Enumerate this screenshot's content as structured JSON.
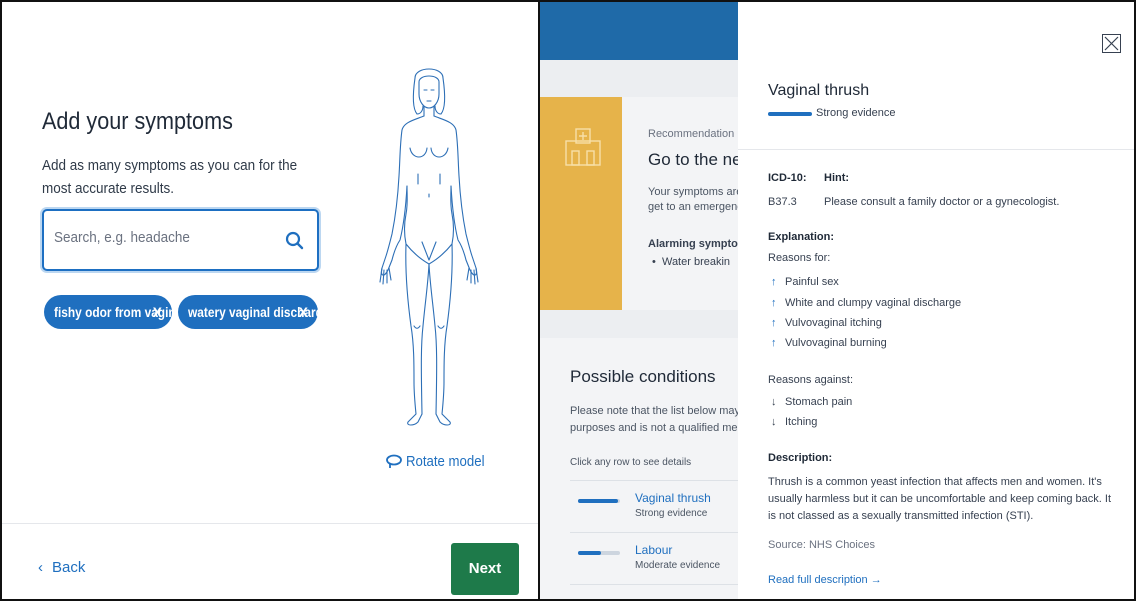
{
  "symptoms_panel": {
    "title": "Add your symptoms",
    "subtitle": "Add as many symptoms as you can for the most accurate results.",
    "search_placeholder": "Search, e.g. headache",
    "chips": [
      {
        "label": "fishy odor from vagina",
        "remove": "X"
      },
      {
        "label": "watery vaginal discharge",
        "remove": "X"
      }
    ],
    "rotate_label": "Rotate model",
    "back_label": "Back",
    "next_label": "Next",
    "icons": {
      "search": "search-icon",
      "remove": "close-icon",
      "rotate": "rotate-icon",
      "back": "chevron-left-icon"
    }
  },
  "results_panel": {
    "recommendation_label": "Recommendation",
    "recommendation_title": "Go to the nea",
    "recommendation_text_1": "Your symptoms are",
    "recommendation_text_2": "get to an emergenc",
    "alarming_label": "Alarming symptom",
    "alarming_items": [
      "Water breakin"
    ],
    "possible_conditions_title": "Possible conditions",
    "note_line_1": "Please note that the list below may",
    "note_line_2": "purposes and is not a qualified med",
    "click_hint": "Click any row to see details",
    "conditions": [
      {
        "name": "Vaginal thrush",
        "evidence": "Strong evidence",
        "strength": 0.95
      },
      {
        "name": "Labour",
        "evidence": "Moderate evidence",
        "strength": 0.55
      }
    ],
    "colors": {
      "header": "#1f6aa8",
      "recommendation_strip": "#e6b34a"
    }
  },
  "detail_panel": {
    "title": "Vaginal thrush",
    "evidence": "Strong evidence",
    "icd_label": "ICD-10:",
    "icd_value": "B37.3",
    "hint_label": "Hint:",
    "hint_value": "Please consult a family doctor or a gynecologist.",
    "explanation_label": "Explanation:",
    "reasons_for_label": "Reasons for:",
    "reasons_for": [
      "Painful sex",
      "White and clumpy vaginal discharge",
      "Vulvovaginal itching",
      "Vulvovaginal burning"
    ],
    "reasons_against_label": "Reasons against:",
    "reasons_against": [
      "Stomach pain",
      "Itching"
    ],
    "description_label": "Description:",
    "description_text": "Thrush is a common yeast infection that affects men and women. It's usually harmless but it can be uncomfortable and keep coming back. It is not classed as a sexually transmitted infection (STI).",
    "source": "Source: NHS Choices",
    "read_more": "Read full description →",
    "icons": {
      "close": "close-icon",
      "up": "arrow-up-icon",
      "down": "arrow-down-icon"
    }
  }
}
